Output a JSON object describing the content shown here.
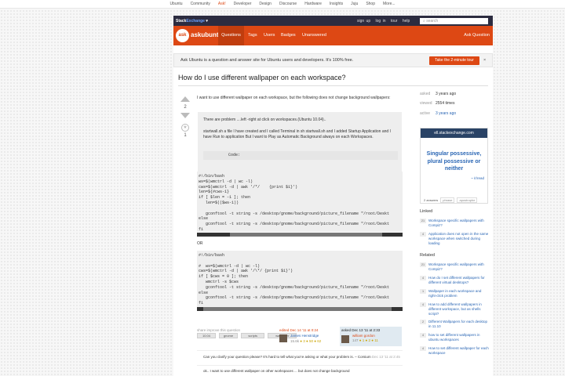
{
  "topnav": {
    "items": [
      "Ubuntu",
      "Community",
      "Ask!",
      "Developer",
      "Design",
      "Discourse",
      "Hardware",
      "Insights",
      "Juju",
      "Shop",
      "More..."
    ],
    "active_index": 2
  },
  "se_bar": {
    "logo_a": "Stack",
    "logo_b": "Exchange",
    "links": [
      "sign up",
      "log in",
      "tour",
      "help"
    ],
    "search_placeholder": "search"
  },
  "site": {
    "brand": "askubuntu",
    "nav": [
      "Questions",
      "Tags",
      "Users",
      "Badges",
      "Unanswered"
    ],
    "ask": "Ask Question"
  },
  "notice": {
    "text": "Ask Ubuntu is a question and answer site for Ubuntu users and developers. It's 100% free.",
    "tour_button": "Take the 2-minute tour",
    "close": "×"
  },
  "question": {
    "title": "How do I use different wallpaper on each workspace?",
    "votes": "2",
    "fav_count": "1",
    "intro": "I want to use different wallpaper on each workspace, but the following does not change background wallpapers:",
    "quote_1": "There are problem ....left -right at click on workspaces.(Ubuntu 10.04)..",
    "quote_2": "startwall.sh a file I have created and I called Terminal in sh startwall.sh and I added Startup Application and I have Run to application But I want to Play as Automatic Background always on each Workspaces.",
    "quote_code": "Code:",
    "code_1": "#!/bin/bash\nws=$(wmctrl -d | wc -l)\ncws=$(wmctrl -d | awk '/*/    {print $1}')\nlen=${#cws-1}\nif [ $len = -1 ]; then\n   len=$(($ws-1))\n\n   gconftool -t string -s /desktop/gnome/background/picture_filename \"/root/Deskt\nelse\n   gconftool -t string -s /desktop/gnome/background/picture_filename \"/root/Deskt\nfi",
    "or": "OR",
    "code_2": "#!/bin/bash\n\n#  ws=$(wmctrl -d | wc -l)\ncws=$(wmctrl -d | awk '/\\*/ {print $1}')\nif [ $cws = 0 ]; then\n   wmctrl -s $cws\n   gconftool -t string -s /desktop/gnome/background/picture_filename \"/root/Deskt\nelse\n   gconftool -t string -s /desktop/gnome/background/picture_filename \"/root/Deskt\nfi",
    "tags": [
      "10.04",
      "gnome",
      "scripts",
      "wallpaper"
    ],
    "share": "share improve this question",
    "edited": {
      "label": "edited Dec 14 '11 at 0:24",
      "name": "James Henstridge",
      "rep": "15.6k",
      "badges": "● 3 ● 50 ● 62"
    },
    "asked": {
      "label": "asked Dec 13 '11 at 2:33",
      "name": "william gordon",
      "rep": "147",
      "badges": "● 1 ● 2 ● 11"
    },
    "comment_1": "Can you clarify your question please? It's hard to tell what you're asking or what your problem is. – Corsium",
    "comment_1_date": "Dec 13 '11 at 2:45",
    "comment_2": "ok.. I want to use different wallpaper on other workspaces ... but does not change background"
  },
  "stats": [
    {
      "label": "asked",
      "value": "3 years ago"
    },
    {
      "label": "viewed",
      "value": "2554 times"
    },
    {
      "label": "active",
      "value": "3 years ago"
    }
  ],
  "ad": {
    "header": "ell.stackexchange.com",
    "body": "Singular possessive, plural possessive or neither",
    "link": "~ /r/read",
    "answers": "2 answers",
    "pill_1": "phrase",
    "pill_2": "apostrophe"
  },
  "linked": {
    "title": "Linked",
    "items": [
      {
        "num": "21",
        "text": "Workspace specific wallpapers with Compiz?"
      },
      {
        "num": "4",
        "text": "Application does not open in the same workspace when switched during loading"
      }
    ]
  },
  "related": {
    "title": "Related",
    "items": [
      {
        "num": "21",
        "text": "Workspace specific wallpapers with Compiz?"
      },
      {
        "num": "4",
        "text": "How do I set different wallpapers for different virtual desktops?"
      },
      {
        "num": "1",
        "text": "Wallpaper in each workspace and right-click problem"
      },
      {
        "num": "4",
        "text": "How to add different wallpapers in different workspace, but as shells script?"
      },
      {
        "num": "2",
        "text": "Different Wallpapers for each desktop in 11.10"
      },
      {
        "num": "4",
        "text": "how to set different wallpapers in ubuntu workspaces"
      },
      {
        "num": "4",
        "text": "How to set different wallpaper for each workspace"
      }
    ]
  },
  "colors": {
    "accent": "#dd4814",
    "topbar": "#2c2c40",
    "link": "#2a66b4"
  }
}
